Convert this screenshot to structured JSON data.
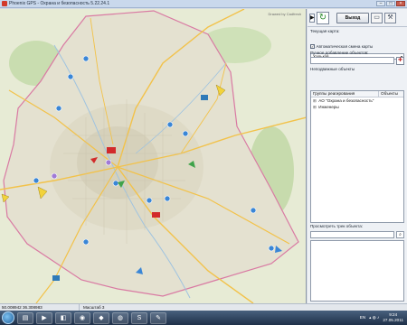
{
  "window": {
    "title": "Phoenix GPS - Охрана и безопасность 5.22.24.1"
  },
  "map": {
    "credit": "Drawed by Cadfresh"
  },
  "toolbar": {
    "exit_label": "Выход"
  },
  "panel": {
    "current_map_label": "Текущая карта:",
    "current_map_value": "Харьков",
    "auto_change_label": "Автоматическая смена карты",
    "auto_change_checked": true,
    "manual_add_label": "Ручное добавление объектов:",
    "stationary_label": "Неподвижные объекты",
    "stationary_value": "Не показывать",
    "groups_col1": "Группы реагирования",
    "groups_col2": "Объекты",
    "groups": [
      {
        "label": "АО \"Охрана и безопасность\""
      },
      {
        "label": "Инженеры"
      }
    ],
    "track_label": "Просмотреть трек объекта:"
  },
  "status": {
    "coords": "50.008942 36.308983",
    "scale": "Масштаб 3"
  },
  "taskbar": {
    "lang": "EN",
    "time": "9:24",
    "date": "27.05.2011"
  },
  "colors": {
    "map_bg": "#e7ebd5",
    "city": "#dfdccb",
    "boundary": "#d97aa3",
    "roads": "#f2c24a"
  }
}
